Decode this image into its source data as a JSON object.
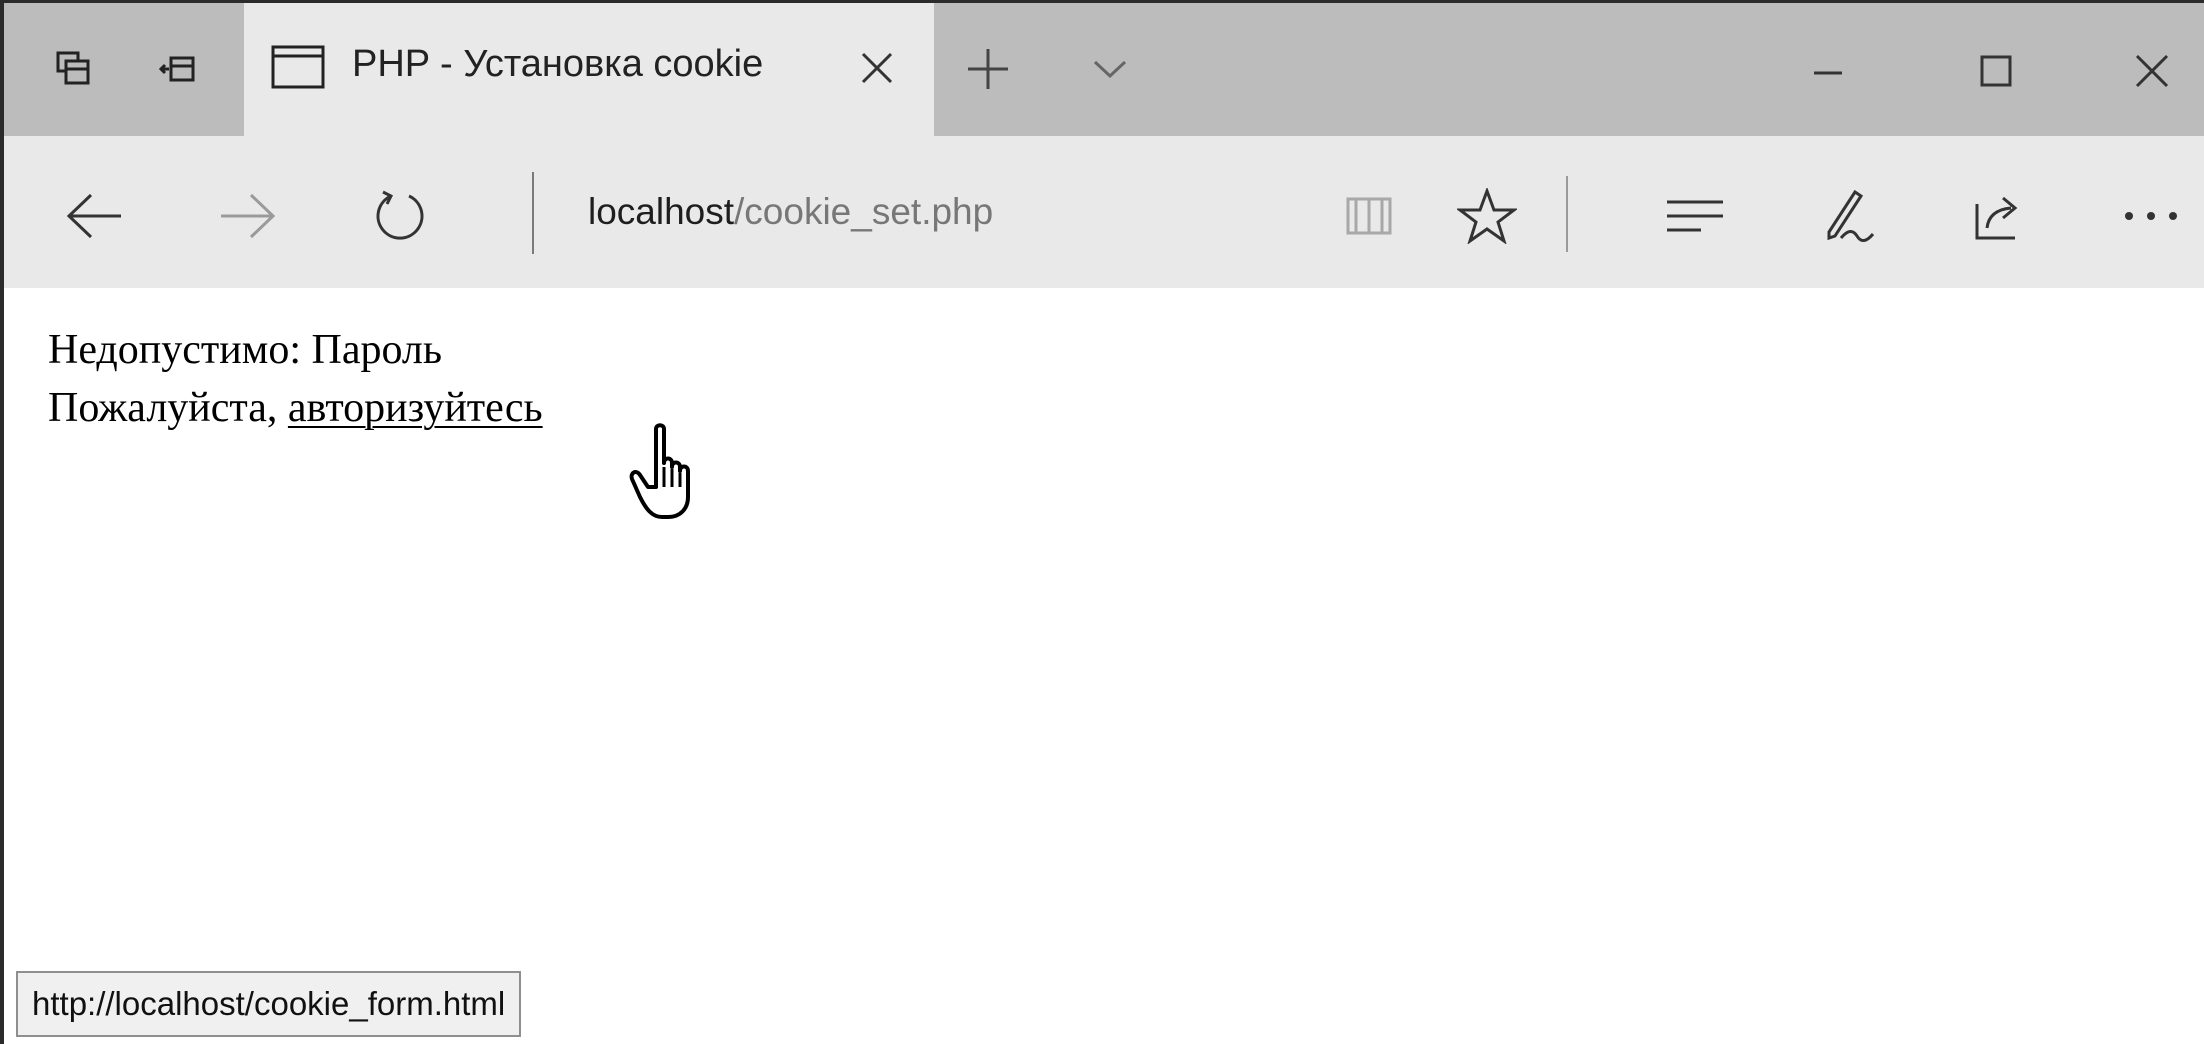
{
  "tab": {
    "title": "PHP - Установка cookie"
  },
  "address": {
    "host": "localhost",
    "path": "/cookie_set.php"
  },
  "content": {
    "line1": "Недопустимо: Пароль",
    "line2_prefix": "Пожалуйста, ",
    "link_text": "авторизуйтесь"
  },
  "status": {
    "url": "http://localhost/cookie_form.html"
  },
  "icons": {
    "tab_group": "tab-preview-icon",
    "set_aside": "set-aside-tabs-icon",
    "tab_page": "page-icon",
    "close_tab": "close-icon",
    "new_tab": "plus-icon",
    "tab_list": "chevron-down-icon",
    "minimize": "minimize-icon",
    "maximize": "maximize-icon",
    "close_window": "close-icon",
    "back": "arrow-left-icon",
    "forward": "arrow-right-icon",
    "refresh": "refresh-icon",
    "reading_view": "book-icon",
    "favorite": "star-icon",
    "hub": "hub-icon",
    "notes": "pen-icon",
    "share": "share-icon",
    "more": "more-icon"
  }
}
